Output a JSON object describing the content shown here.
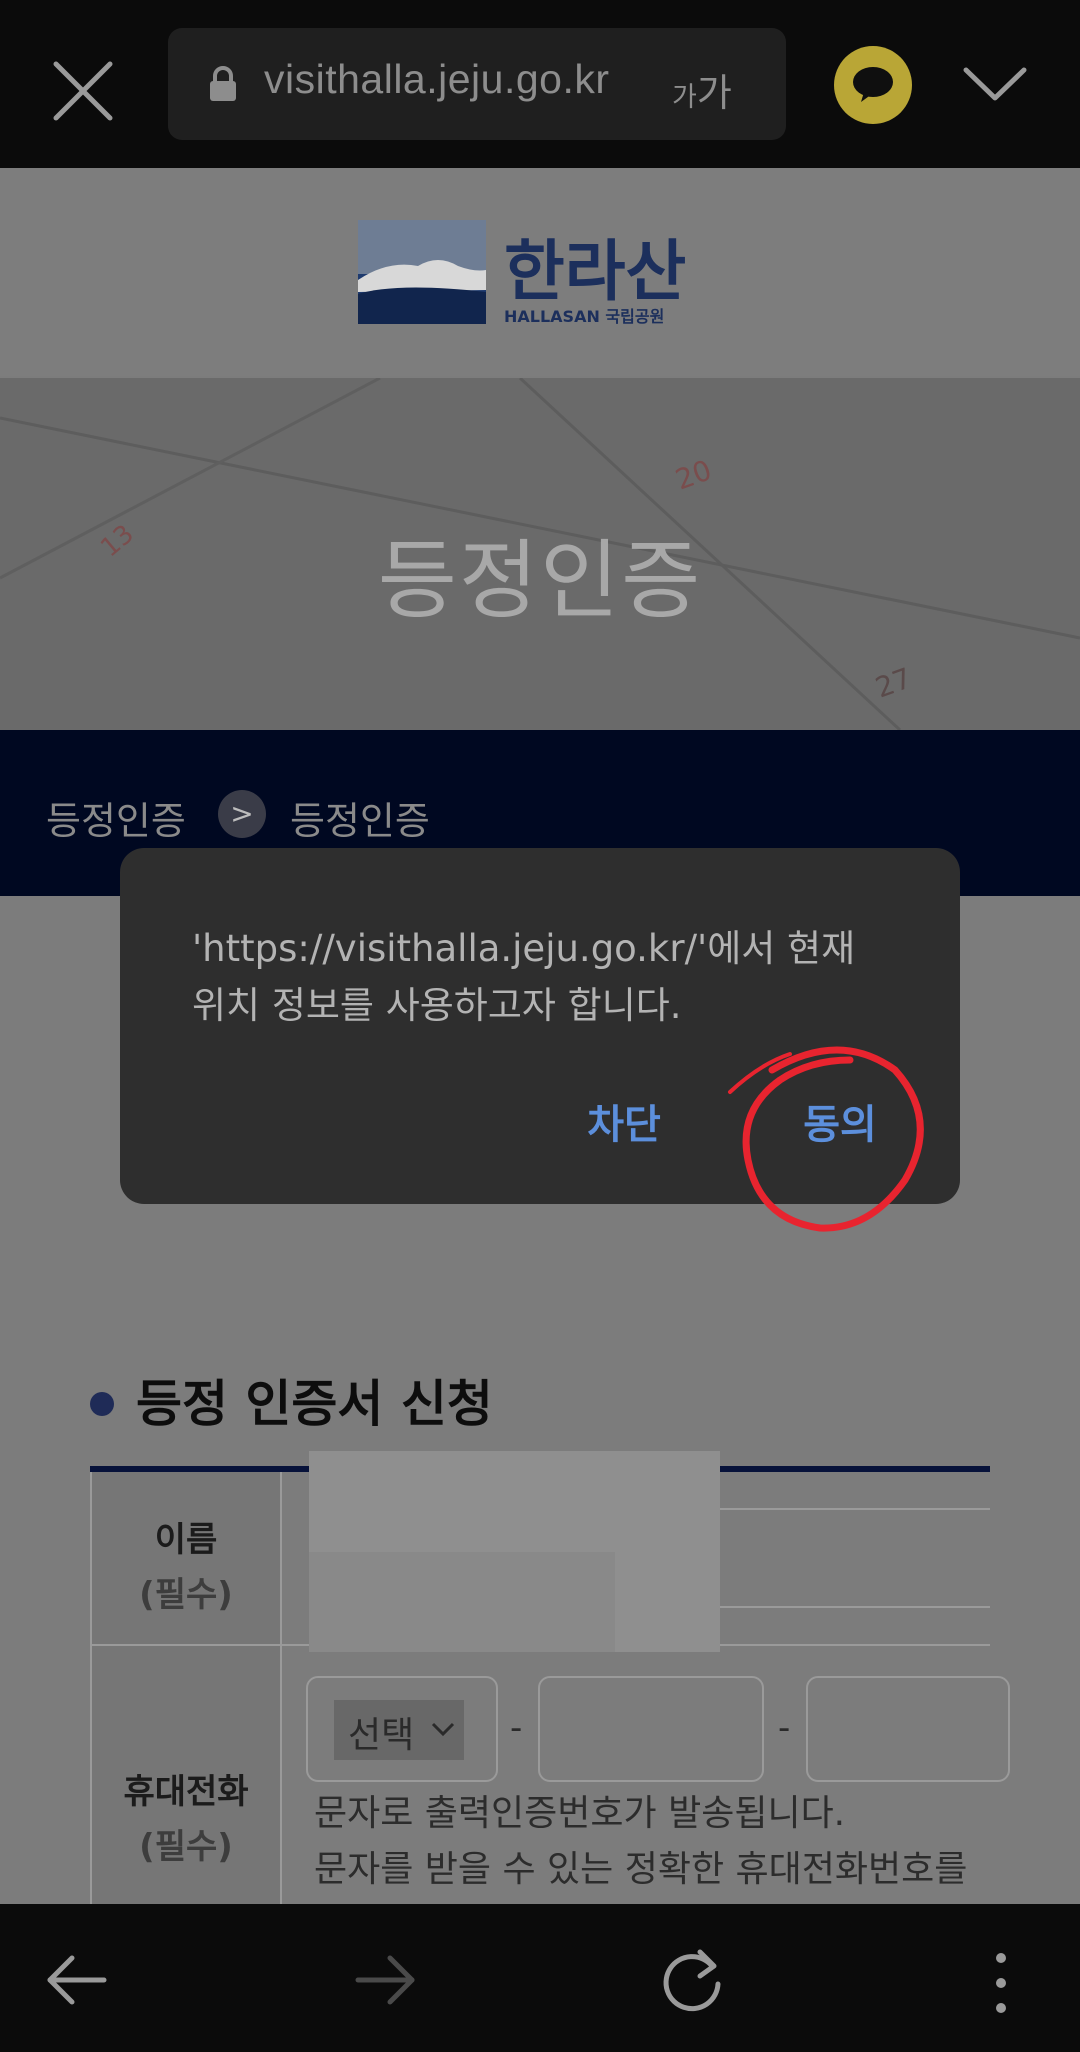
{
  "browser": {
    "url": "visithalla.jeju.go.kr",
    "text_size_label_small": "가",
    "text_size_label_large": "가"
  },
  "site": {
    "logo_text": "한라산",
    "logo_subtext": "HALLASAN 국립공원",
    "hero_title": "등정인증",
    "breadcrumb": [
      "등정인증",
      "등정인증"
    ],
    "breadcrumb_sep": ">"
  },
  "form": {
    "section_title": "등정 인증서 신청",
    "rows": [
      {
        "label": "이름",
        "required": "(필수)"
      },
      {
        "label": "휴대전화",
        "required": "(필수)"
      }
    ],
    "phone_select": "선택",
    "dash": "-",
    "help_lines": [
      "문자로 출력인증번호가 발송됩니다.",
      "문자를 받을 수 있는 정확한 휴대전화번호를"
    ]
  },
  "dialog": {
    "message_line1": "'https://visithalla.jeju.go.kr/'에서 현재",
    "message_line2": "위치 정보를 사용하고자 합니다.",
    "block_label": "차단",
    "allow_label": "동의"
  },
  "colors": {
    "accent_button": "#5c8fdc",
    "annotation_circle": "#e8242f",
    "nav_band": "#000821"
  },
  "icons": [
    "close-icon",
    "lock-icon",
    "kakao-chat-icon",
    "chevron-down-icon",
    "back-arrow-icon",
    "forward-arrow-icon",
    "reload-icon",
    "more-vert-icon"
  ]
}
